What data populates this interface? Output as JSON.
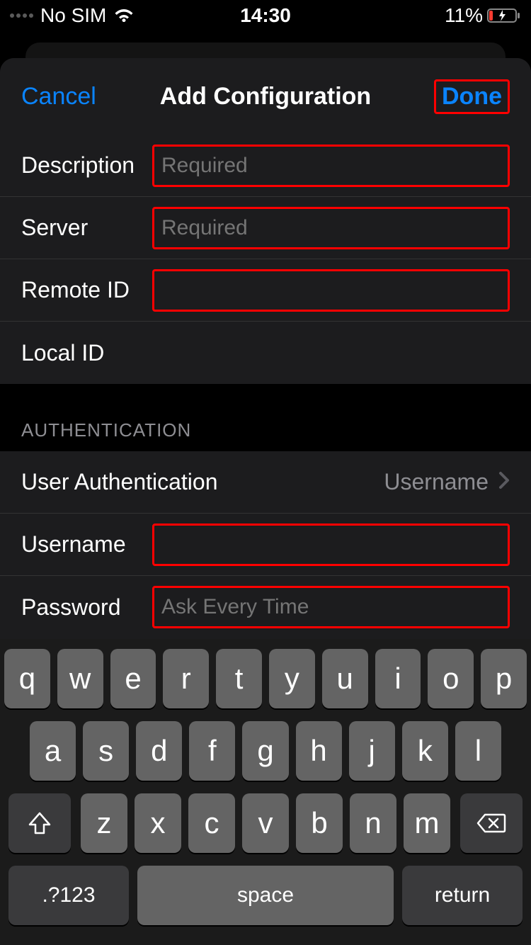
{
  "statusbar": {
    "carrier": "No SIM",
    "time": "14:30",
    "battery_pct": "11%"
  },
  "nav": {
    "cancel": "Cancel",
    "title": "Add Configuration",
    "done": "Done"
  },
  "fields": {
    "description": {
      "label": "Description",
      "value": "",
      "placeholder": "Required"
    },
    "server": {
      "label": "Server",
      "value": "",
      "placeholder": "Required"
    },
    "remote_id": {
      "label": "Remote ID",
      "value": "",
      "placeholder": ""
    },
    "local_id": {
      "label": "Local ID",
      "value": "",
      "placeholder": ""
    }
  },
  "auth": {
    "section_title": "AUTHENTICATION",
    "user_auth_label": "User Authentication",
    "user_auth_value": "Username",
    "username": {
      "label": "Username",
      "value": "",
      "placeholder": ""
    },
    "password": {
      "label": "Password",
      "value": "",
      "placeholder": "Ask Every Time"
    }
  },
  "keyboard": {
    "row1": [
      "q",
      "w",
      "e",
      "r",
      "t",
      "y",
      "u",
      "i",
      "o",
      "p"
    ],
    "row2": [
      "a",
      "s",
      "d",
      "f",
      "g",
      "h",
      "j",
      "k",
      "l"
    ],
    "row3": [
      "z",
      "x",
      "c",
      "v",
      "b",
      "n",
      "m"
    ],
    "numbers_key": ".?123",
    "space_key": "space",
    "return_key": "return"
  }
}
